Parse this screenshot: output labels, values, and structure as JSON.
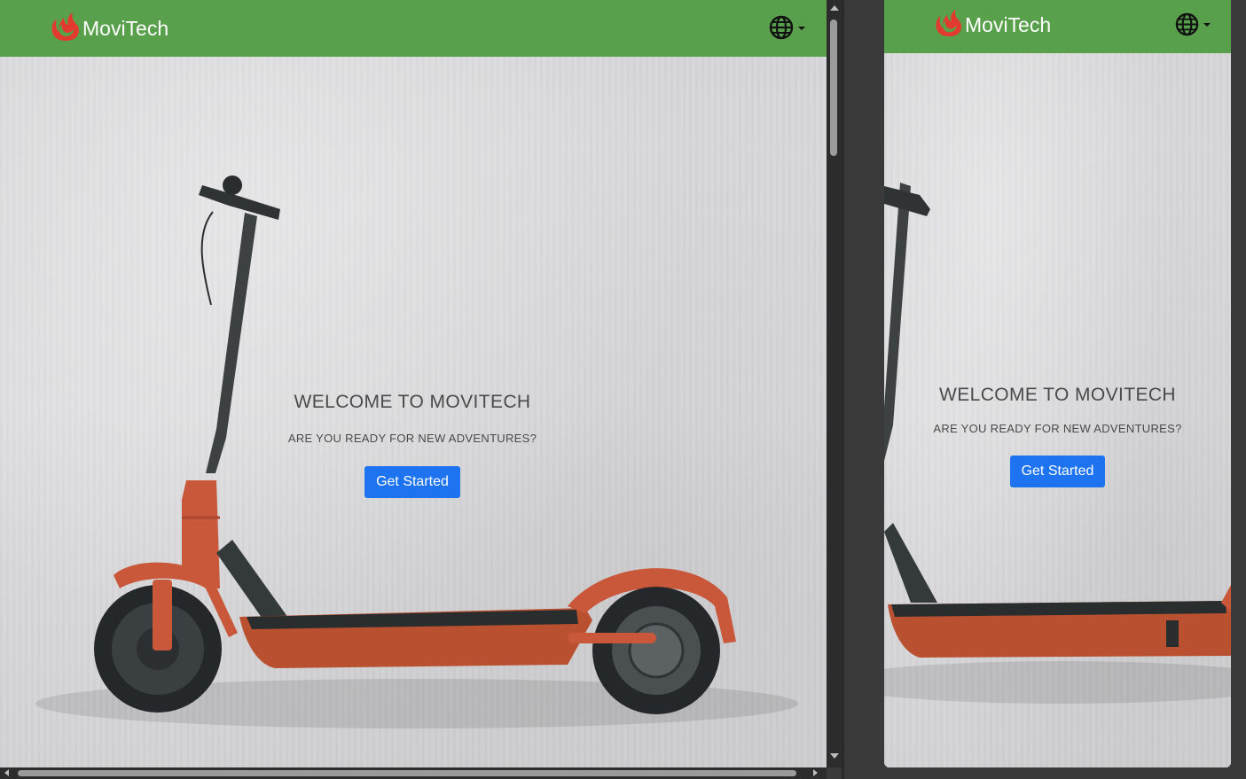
{
  "brand": {
    "name": "MoviTech",
    "logo_icon": "flame-logo-icon",
    "logo_color": "#e23b2e"
  },
  "navbar": {
    "bg_color": "#58a04b",
    "language_icon": "globe-icon"
  },
  "hero": {
    "title": "WELCOME TO MOVITECH",
    "subtitle": "ARE YOU READY FOR NEW ADVENTURES?",
    "cta_label": "Get Started",
    "cta_color": "#1e73f0",
    "background_image": "electric scooter leaning on white plaster wall"
  },
  "views": {
    "left": "desktop-view",
    "right": "mobile-view"
  }
}
